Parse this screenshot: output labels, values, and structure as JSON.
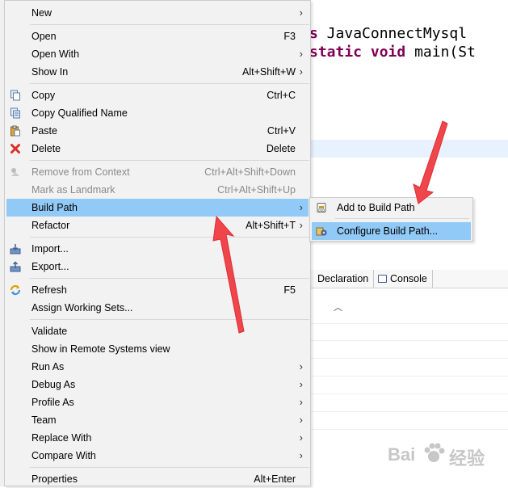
{
  "editor": {
    "line1_keyword": "s",
    "line1_text": " JavaConnectMysql",
    "line2_kw1": "static",
    "line2_kw2": "void",
    "line2_text": " main(St"
  },
  "views": {
    "declaration_tab": "Declaration",
    "console_tab": "Console"
  },
  "menu": {
    "items": [
      {
        "label": "New",
        "shortcut": "",
        "submenu": true,
        "disabled": false
      },
      {
        "label": "Open",
        "shortcut": "F3",
        "submenu": false,
        "disabled": false
      },
      {
        "label": "Open With",
        "shortcut": "",
        "submenu": true,
        "disabled": false
      },
      {
        "label": "Show In",
        "shortcut": "Alt+Shift+W",
        "submenu": true,
        "disabled": false
      },
      {
        "label": "Copy",
        "shortcut": "Ctrl+C",
        "submenu": false,
        "disabled": false
      },
      {
        "label": "Copy Qualified Name",
        "shortcut": "",
        "submenu": false,
        "disabled": false
      },
      {
        "label": "Paste",
        "shortcut": "Ctrl+V",
        "submenu": false,
        "disabled": false
      },
      {
        "label": "Delete",
        "shortcut": "Delete",
        "submenu": false,
        "disabled": false
      },
      {
        "label": "Remove from Context",
        "shortcut": "Ctrl+Alt+Shift+Down",
        "submenu": false,
        "disabled": true
      },
      {
        "label": "Mark as Landmark",
        "shortcut": "Ctrl+Alt+Shift+Up",
        "submenu": false,
        "disabled": true
      },
      {
        "label": "Build Path",
        "shortcut": "",
        "submenu": true,
        "disabled": false,
        "selected": true
      },
      {
        "label": "Refactor",
        "shortcut": "Alt+Shift+T",
        "submenu": true,
        "disabled": false
      },
      {
        "label": "Import...",
        "shortcut": "",
        "submenu": false,
        "disabled": false
      },
      {
        "label": "Export...",
        "shortcut": "",
        "submenu": false,
        "disabled": false
      },
      {
        "label": "Refresh",
        "shortcut": "F5",
        "submenu": false,
        "disabled": false
      },
      {
        "label": "Assign Working Sets...",
        "shortcut": "",
        "submenu": false,
        "disabled": false
      },
      {
        "label": "Validate",
        "shortcut": "",
        "submenu": false,
        "disabled": false
      },
      {
        "label": "Show in Remote Systems view",
        "shortcut": "",
        "submenu": false,
        "disabled": false
      },
      {
        "label": "Run As",
        "shortcut": "",
        "submenu": true,
        "disabled": false
      },
      {
        "label": "Debug As",
        "shortcut": "",
        "submenu": true,
        "disabled": false
      },
      {
        "label": "Profile As",
        "shortcut": "",
        "submenu": true,
        "disabled": false
      },
      {
        "label": "Team",
        "shortcut": "",
        "submenu": true,
        "disabled": false
      },
      {
        "label": "Replace With",
        "shortcut": "",
        "submenu": true,
        "disabled": false
      },
      {
        "label": "Compare With",
        "shortcut": "",
        "submenu": true,
        "disabled": false
      },
      {
        "label": "Properties",
        "shortcut": "Alt+Enter",
        "submenu": false,
        "disabled": false
      }
    ],
    "submenu_arrow": "›"
  },
  "submenu": {
    "items": [
      {
        "label": "Add to Build Path",
        "selected": false
      },
      {
        "label": "Configure Build Path...",
        "selected": true
      }
    ]
  },
  "watermark": {
    "text": "Bai",
    "text2": "经验"
  },
  "colors": {
    "selection": "#91c9f7",
    "menu_bg": "#f2f2f2",
    "annotation_arrow": "#f0454a",
    "keyword": "#7f0055"
  }
}
